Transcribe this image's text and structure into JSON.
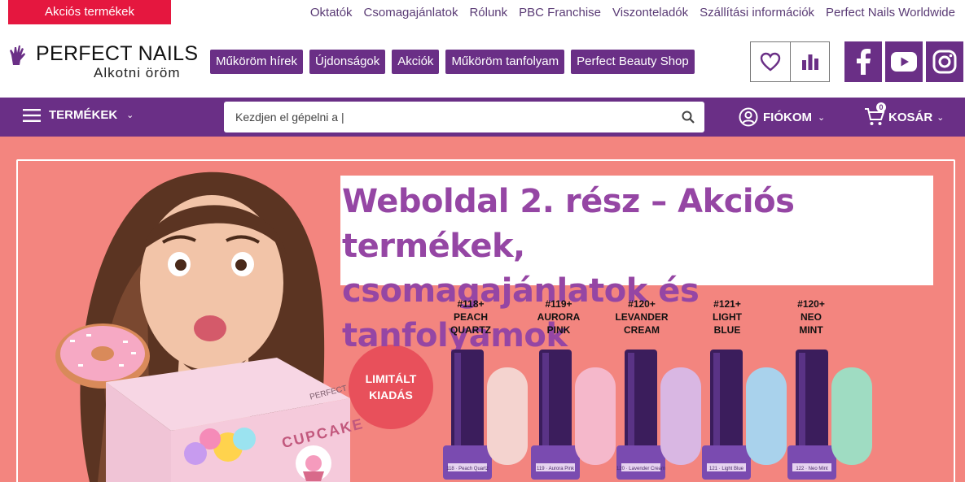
{
  "topbar": {
    "promo_label": "Akciós termékek",
    "links": [
      "Oktatók",
      "Csomagajánlatok",
      "Rólunk",
      "PBC Franchise",
      "Viszonteladók",
      "Szállítási információk",
      "Perfect Nails Worldwide"
    ]
  },
  "header": {
    "logo_name": "PERFECT NAILS",
    "logo_tagline": "Alkotni öröm",
    "nav_pills": [
      "Műköröm hírek",
      "Újdonságok",
      "Akciók",
      "Műköröm tanfolyam",
      "Perfect Beauty Shop"
    ],
    "icons": [
      "heart-icon",
      "chart-icon",
      "facebook-icon",
      "youtube-icon",
      "instagram-icon"
    ]
  },
  "navbar": {
    "products_label": "TERMÉKEK",
    "search_value": "Kezdjen el gépelni a |",
    "account_label": "FIÓKOM",
    "cart_label": "KOSÁR",
    "cart_count": "0"
  },
  "hero": {
    "overlay_title_line1": "Weboldal 2. rész – Akciós termékek,",
    "overlay_title_line2": "csomagajánlatok és tanfolyamok",
    "badge_line1": "LIMITÁLT",
    "badge_line2": "KIADÁS",
    "kit_brand": "PERFECT",
    "kit_title": "CUPCAKE",
    "bottles": [
      {
        "number": "#118+",
        "name1": "PEACH",
        "name2": "QUARTZ",
        "bottle_text": "118 · Peach Quartz",
        "swatch": "#f4d3cf"
      },
      {
        "number": "#119+",
        "name1": "AURORA",
        "name2": "PINK",
        "bottle_text": "119 · Aurora Pink",
        "swatch": "#f5b8cb"
      },
      {
        "number": "#120+",
        "name1": "LEVANDER",
        "name2": "CREAM",
        "bottle_text": "120 · Lavender Cream",
        "swatch": "#d9b7e3"
      },
      {
        "number": "#121+",
        "name1": "LIGHT",
        "name2": "BLUE",
        "bottle_text": "121 · Light Blue",
        "swatch": "#a9d2ec"
      },
      {
        "number": "#120+",
        "name1": "NEO",
        "name2": "MINT",
        "bottle_text": "122 · Neo Mint",
        "swatch": "#9fdcc2"
      }
    ]
  },
  "colors": {
    "brand_purple": "#6a2f86",
    "promo_red": "#e5173f",
    "hero_bg": "#f3857f",
    "title_purple": "#9546a4"
  }
}
